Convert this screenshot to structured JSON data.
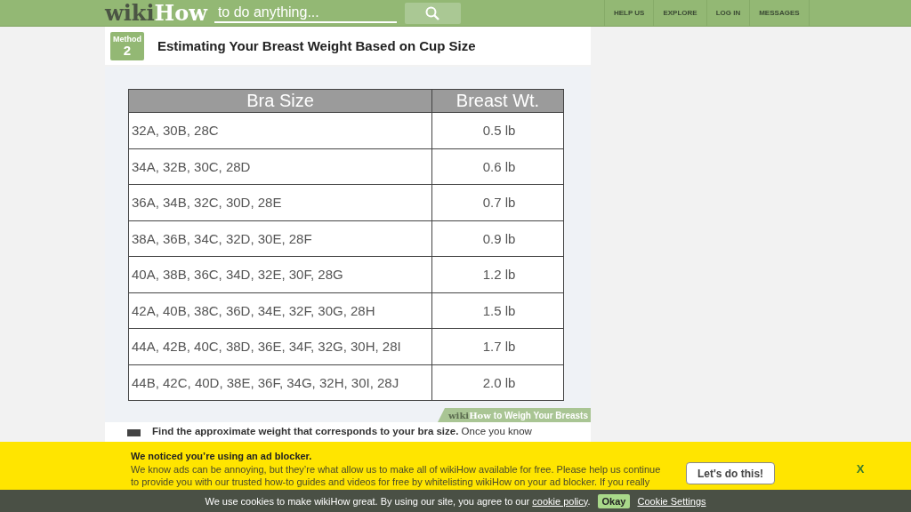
{
  "header": {
    "logo_wiki": "wiki",
    "logo_how": "How",
    "search": {
      "placeholder": "to do anything..."
    },
    "nav": [
      "HELP US",
      "EXPLORE",
      "LOG IN",
      "MESSAGES"
    ]
  },
  "method": {
    "label": "Method",
    "number": "2",
    "title": "Estimating Your Breast Weight Based on Cup Size"
  },
  "table": {
    "columns": [
      "Bra Size",
      "Breast Wt."
    ],
    "rows": [
      [
        "32A, 30B, 28C",
        "0.5 lb"
      ],
      [
        "34A, 32B, 30C, 28D",
        "0.6 lb"
      ],
      [
        "36A, 34B, 32C, 30D, 28E",
        "0.7 lb"
      ],
      [
        "38A, 36B, 34C, 32D, 30E, 28F",
        "0.9 lb"
      ],
      [
        "40A, 38B, 36C, 34D, 32E, 30F, 28G",
        "1.2 lb"
      ],
      [
        "42A, 40B, 38C, 36D, 34E, 32F, 30G, 28H",
        "1.5 lb"
      ],
      [
        "44A, 42B, 40C, 38D, 36E, 34F, 32G, 30H, 28I",
        "1.7 lb"
      ],
      [
        "44B, 42C, 40D, 38E, 36F, 34G, 32H, 30I, 28J",
        "2.0 lb"
      ]
    ]
  },
  "caption": {
    "wiki": "wiki",
    "how": "How",
    "text": "to Weigh Your Breasts"
  },
  "step": {
    "text": "**Find the approximate weight that corresponds to your bra size.** Once you know"
  },
  "ad_banner": {
    "title": "We noticed you’re using an ad blocker.",
    "body": "We know ads can be annoying, but they’re what allow us to make all of wikiHow available for free. Please help us continue to provide you with our trusted how-to guides and videos for free by whitelisting wikiHow on your ad blocker. If you really",
    "button": "Let's do this!",
    "close": "X"
  },
  "cookie_bar": {
    "text": "We use cookies to make wikiHow great. By using our site, you agree to our",
    "link": "cookie policy",
    "after": ".",
    "okay": "Okay",
    "settings": "Cookie Settings"
  }
}
